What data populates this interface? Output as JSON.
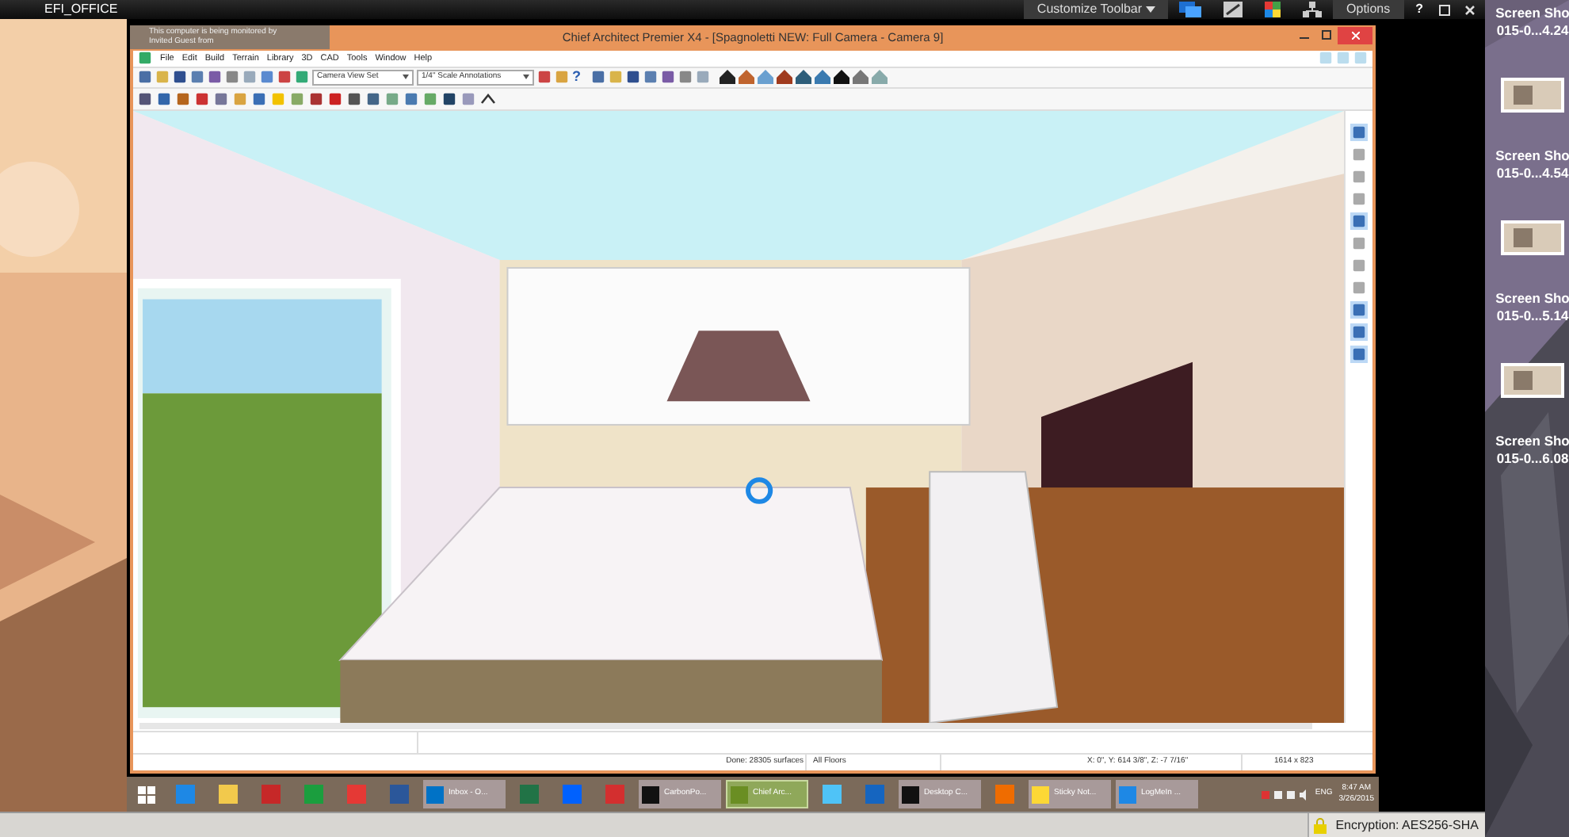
{
  "remote_bar": {
    "title": "EFI_OFFICE",
    "customize": "Customize Toolbar",
    "options": "Options",
    "help": "?"
  },
  "notification": {
    "lines": [
      "This computer is being monitored by",
      "Invited Guest from"
    ]
  },
  "window": {
    "title": "Chief Architect Premier X4 - [Spagnoletti NEW: Full Camera - Camera 9]",
    "menu": [
      "File",
      "Edit",
      "Build",
      "Terrain",
      "Library",
      "3D",
      "CAD",
      "Tools",
      "Window",
      "Help"
    ],
    "dropdowns": [
      "Camera View Set",
      "1/4\" Scale Annotations"
    ],
    "help_glyph": "?"
  },
  "status_bar": [
    "Done: 28305 surfaces",
    "All Floors",
    "X: 0\", Y: 614 3/8\", Z: -7 7/16\"",
    "1614 x 823"
  ],
  "taskbar": {
    "items": [
      {
        "kind": "start"
      },
      {
        "kind": "pinned",
        "color": "#1e88e5"
      },
      {
        "kind": "pinned",
        "color": "#f2c94c"
      },
      {
        "kind": "pinned",
        "color": "#c62828"
      },
      {
        "kind": "pinned",
        "color": "#1b9e3e"
      },
      {
        "kind": "pinned",
        "color": "#e53935"
      },
      {
        "kind": "pinned",
        "color": "#2b579a"
      },
      {
        "kind": "window",
        "color": "#0072c6",
        "label": "Inbox - O...",
        "selected": false
      },
      {
        "kind": "pinned",
        "color": "#217346"
      },
      {
        "kind": "pinned",
        "color": "#0061fe"
      },
      {
        "kind": "pinned",
        "color": "#d32f2f"
      },
      {
        "kind": "window",
        "color": "#111111",
        "label": "CarbonPo...",
        "selected": false
      },
      {
        "kind": "window",
        "color": "#6a8e23",
        "label": "Chief Arc...",
        "selected": true
      },
      {
        "kind": "pinned",
        "color": "#4fc3f7"
      },
      {
        "kind": "pinned",
        "color": "#1565c0"
      },
      {
        "kind": "window",
        "color": "#111111",
        "label": "Desktop C...",
        "selected": false
      },
      {
        "kind": "pinned",
        "color": "#ef6c00"
      },
      {
        "kind": "window",
        "color": "#fdd835",
        "label": "Sticky Not...",
        "selected": false
      },
      {
        "kind": "window",
        "color": "#1e88e5",
        "label": "LogMeIn ...",
        "selected": false
      }
    ],
    "language": "ENG",
    "time": "8:47 AM",
    "date": "3/26/2015"
  },
  "session_bar": {
    "encryption": "Encryption: AES256-SHA"
  },
  "desktop_icons": [
    {
      "line1": "Screen Sho",
      "line2": "015-0...4.24"
    },
    {
      "line1": "Screen Sho",
      "line2": "015-0...4.54"
    },
    {
      "line1": "Screen Sho",
      "line2": "015-0...5.14"
    },
    {
      "line1": "Screen Sho",
      "line2": "015-0...6.08"
    }
  ]
}
